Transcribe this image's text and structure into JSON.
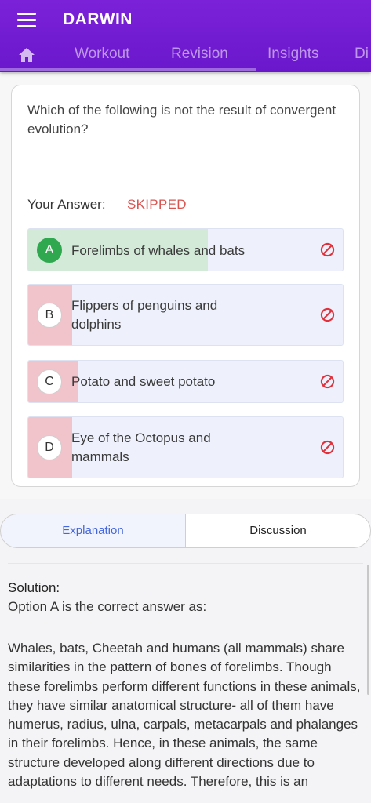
{
  "app": {
    "title": "DARWIN"
  },
  "tabs": [
    {
      "label": "Workout"
    },
    {
      "label": "Revision"
    },
    {
      "label": "Insights"
    },
    {
      "label": "Di"
    }
  ],
  "question": {
    "text": "Which of the following is not the result of convergent evolution?",
    "your_answer_label": "Your Answer:",
    "your_answer_value": "SKIPPED"
  },
  "options": [
    {
      "letter": "A",
      "text": "Forelimbs of whales and bats",
      "correct": true,
      "percent": 0.57
    },
    {
      "letter": "B",
      "text": "Flippers of penguins and dolphins",
      "correct": false,
      "percent": 0.14
    },
    {
      "letter": "C",
      "text": "Potato and sweet potato",
      "correct": false,
      "percent": 0.16
    },
    {
      "letter": "D",
      "text": "Eye of the Octopus and mammals",
      "correct": false,
      "percent": 0.14
    }
  ],
  "segment": {
    "explanation": "Explanation",
    "discussion": "Discussion"
  },
  "solution": {
    "title": "Solution:",
    "intro": "Option A is the correct answer as:",
    "body": "Whales, bats, Cheetah and humans (all mammals) share similarities in the pattern of bones of forelimbs. Though these forelimbs perform different functions in these animals, they have similar anatomical structure- all of them have humerus, radius, ulna, carpals, metacarpals and phalanges in their forelimbs. Hence, in these animals, the same structure developed along different directions due to adaptations to different needs. Therefore, this is an"
  },
  "colors": {
    "brand": "#6a17cc",
    "correct_fill": "#d2ead7",
    "correct_badge": "#2fa84f",
    "wrong_fill": "#f1c4cc",
    "ban_icon": "#e0323c",
    "skipped": "#d9534f"
  }
}
